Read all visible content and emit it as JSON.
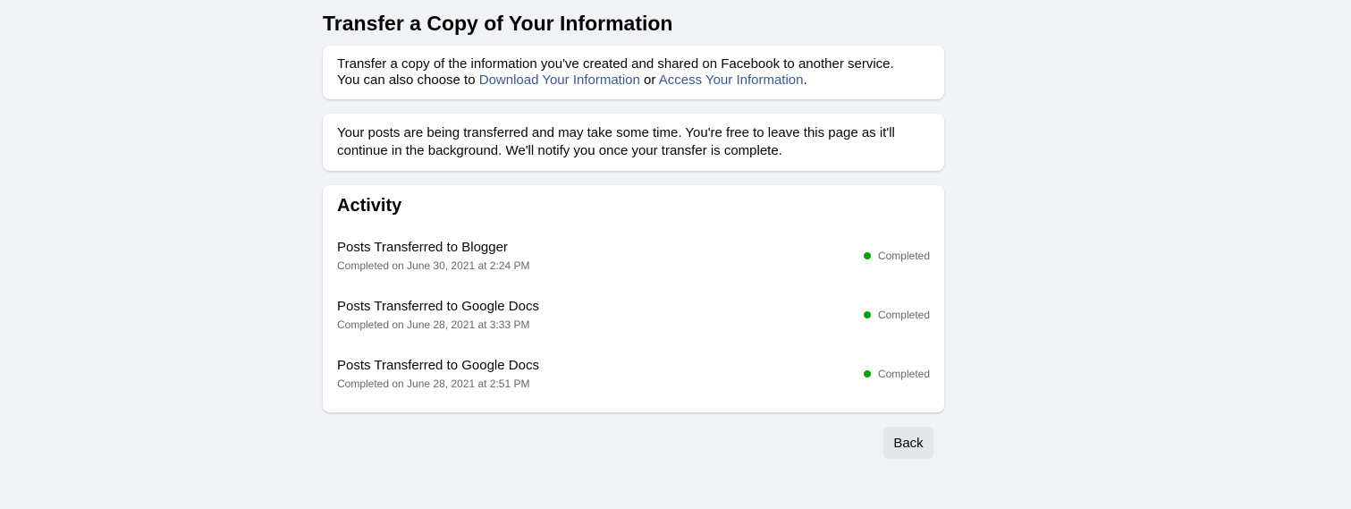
{
  "page": {
    "title": "Transfer a Copy of Your Information"
  },
  "intro": {
    "line1": "Transfer a copy of the information you've created and shared on Facebook to another service.",
    "line2_prefix": "You can also choose to ",
    "link_download": "Download Your Information",
    "connector": " or ",
    "link_access": "Access Your Information",
    "suffix": "."
  },
  "notice": {
    "text": "Your posts are being transferred and may take some time. You're free to leave this page as it'll continue in the background. We'll notify you once your transfer is complete."
  },
  "activity": {
    "heading": "Activity",
    "items": [
      {
        "title": "Posts Transferred to Blogger",
        "subtitle": "Completed on June 30, 2021 at 2:24 PM",
        "status": "Completed"
      },
      {
        "title": "Posts Transferred to Google Docs",
        "subtitle": "Completed on June 28, 2021 at 3:33 PM",
        "status": "Completed"
      },
      {
        "title": "Posts Transferred to Google Docs",
        "subtitle": "Completed on June 28, 2021 at 2:51 PM",
        "status": "Completed"
      }
    ]
  },
  "footer": {
    "back_label": "Back"
  },
  "colors": {
    "status_completed": "#00a400",
    "link": "#385898",
    "background": "#f0f2f5"
  }
}
